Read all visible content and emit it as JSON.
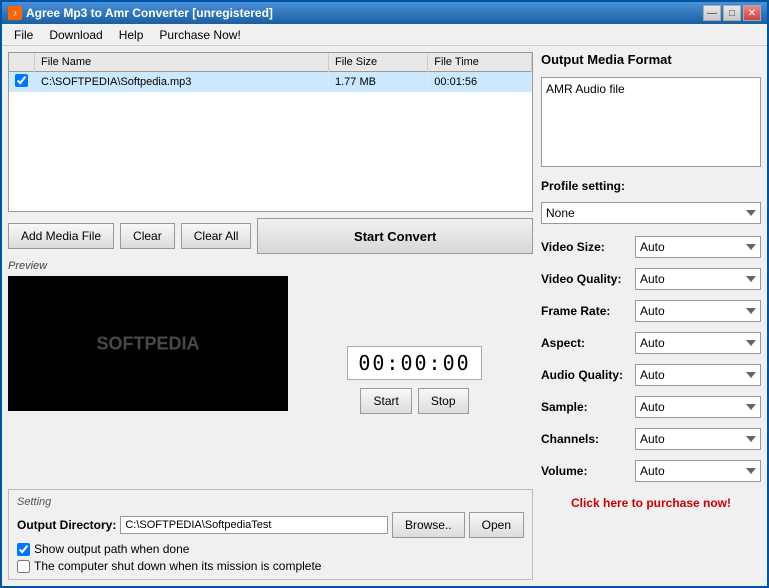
{
  "window": {
    "title": "Agree Mp3 to Amr Converter [unregistered]",
    "icon": "♪"
  },
  "titleControls": {
    "minimize": "—",
    "maximize": "□",
    "close": "✕"
  },
  "menu": {
    "items": [
      "File",
      "Download",
      "Help",
      "Purchase Now!"
    ]
  },
  "fileTable": {
    "columns": [
      "",
      "File Name",
      "File Size",
      "File Time"
    ],
    "rows": [
      {
        "checked": true,
        "name": "C:\\SOFTPEDIA\\Softpedia.mp3",
        "size": "1.77 MB",
        "time": "00:01:56"
      }
    ]
  },
  "buttons": {
    "addMediaFile": "Add Media File",
    "clear": "Clear",
    "clearAll": "Clear All",
    "startConvert": "Start Convert",
    "start": "Start",
    "stop": "Stop",
    "browse": "Browse..",
    "open": "Open"
  },
  "preview": {
    "label": "Preview",
    "watermark": "SOFTPEDIA",
    "timeDisplay": "00:00:00"
  },
  "setting": {
    "label": "Setting",
    "outputDirLabel": "Output Directory:",
    "outputDirValue": "C:\\SOFTPEDIA\\SoftpediaTest",
    "showOutputPath": "Show output path when done",
    "shutdownOption": "The computer shut down when its mission is complete"
  },
  "rightPanel": {
    "outputFormatLabel": "Output Media Format",
    "outputFormatValue": "AMR Audio file",
    "profileLabel": "Profile setting:",
    "profileValue": "None",
    "settings": [
      {
        "label": "Video Size:",
        "value": "Auto"
      },
      {
        "label": "Video Quality:",
        "value": "Auto"
      },
      {
        "label": "Frame Rate:",
        "value": "Auto"
      },
      {
        "label": "Aspect:",
        "value": "Auto"
      },
      {
        "label": "Audio Quality:",
        "value": "Auto"
      },
      {
        "label": "Sample:",
        "value": "Auto"
      },
      {
        "label": "Channels:",
        "value": "Auto"
      },
      {
        "label": "Volume:",
        "value": "Auto"
      }
    ],
    "purchaseLink": "Click here to purchase now!"
  }
}
